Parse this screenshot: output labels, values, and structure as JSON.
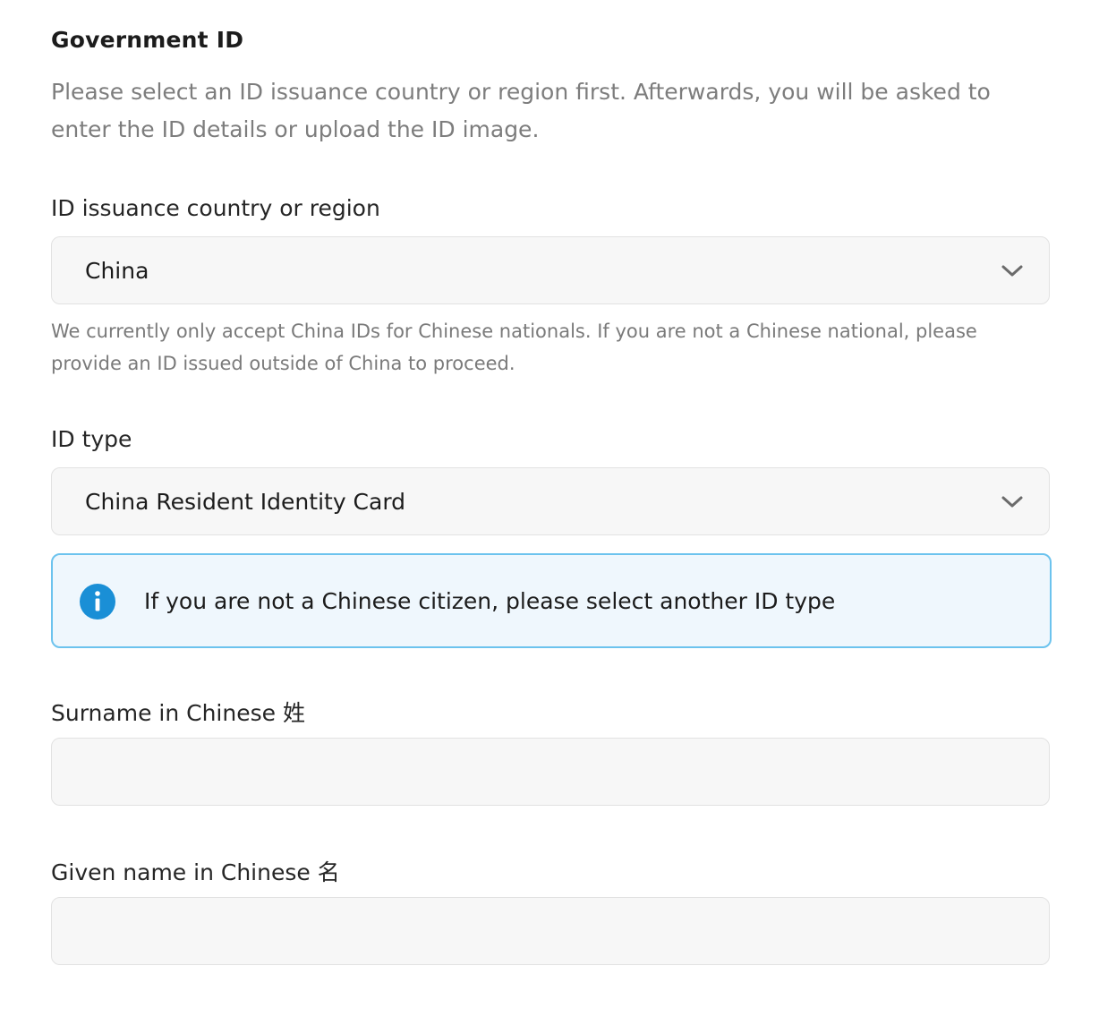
{
  "section": {
    "title": "Government ID",
    "description": "Please select an ID issuance country or region first. Afterwards, you will be asked to enter the ID details or upload the ID image."
  },
  "country_field": {
    "label": "ID issuance country or region",
    "selected": "China",
    "help_text": "We currently only accept China IDs for Chinese nationals. If you are not a Chinese national, please provide an ID issued outside of China to proceed."
  },
  "id_type_field": {
    "label": "ID type",
    "selected": "China Resident Identity Card"
  },
  "info_notice": {
    "icon": "info-icon",
    "text": "If you are not a Chinese citizen, please select another ID type"
  },
  "surname_field": {
    "label": "Surname in Chinese 姓",
    "value": ""
  },
  "given_name_field": {
    "label": "Given name in Chinese 名",
    "value": ""
  },
  "colors": {
    "info_accent": "#1a8fd6",
    "info_border": "#6cc3ee",
    "info_background": "#eff7fd",
    "input_background": "#f7f7f7"
  }
}
